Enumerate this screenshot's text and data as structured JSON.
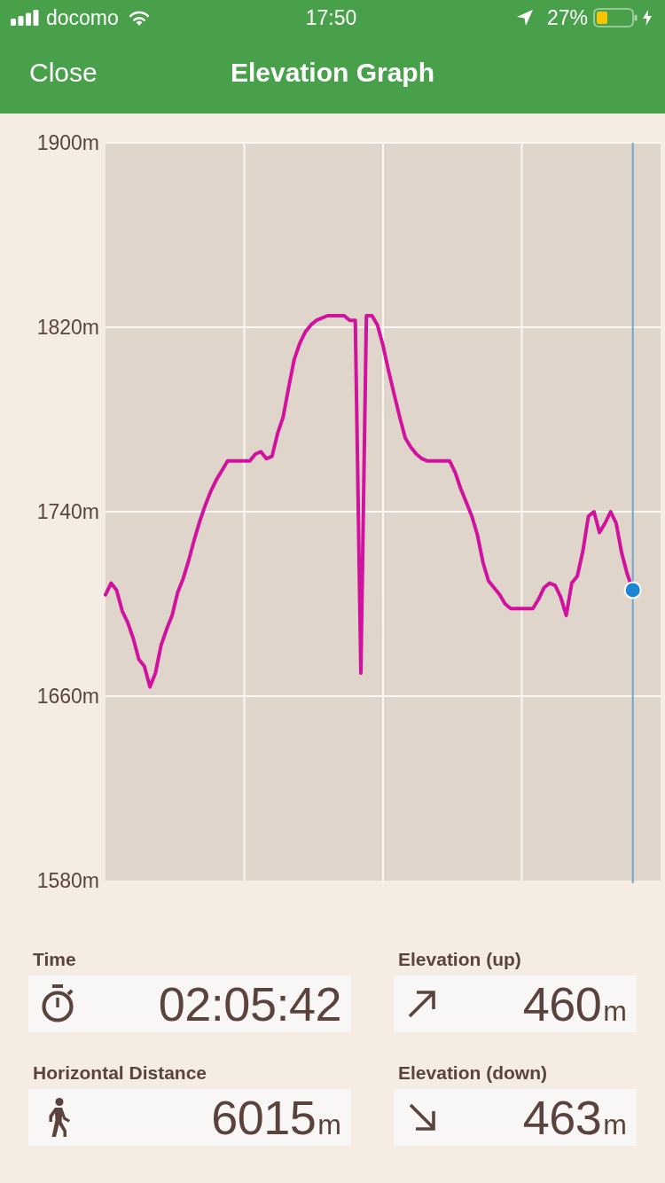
{
  "status_bar": {
    "carrier": "docomo",
    "time": "17:50",
    "battery": "27%"
  },
  "nav_bar": {
    "close_button": "Close",
    "title": "Elevation Graph"
  },
  "chart": {
    "chart_data": {
      "type": "line",
      "categories": [
        null,
        null,
        null,
        null,
        null,
        null,
        null,
        null,
        null,
        null,
        null,
        null,
        null,
        null,
        null,
        null,
        null,
        null,
        null,
        null,
        null,
        null,
        null,
        null,
        null,
        null,
        null,
        null,
        null,
        null,
        null,
        null,
        null,
        null,
        null,
        null,
        null,
        null,
        null,
        null,
        null,
        null,
        null,
        null,
        null,
        null,
        null,
        null,
        null,
        null,
        null,
        null,
        null,
        null,
        null,
        null,
        null,
        null,
        null,
        null,
        null,
        null,
        null,
        null,
        null,
        null,
        null,
        null,
        null,
        null,
        null,
        null,
        null,
        null,
        null,
        null,
        null,
        null,
        null,
        null,
        null,
        null,
        null,
        null,
        null,
        null,
        null,
        null,
        null,
        null,
        null,
        null,
        null,
        null,
        null,
        null,
        null,
        null,
        null,
        null,
        null
      ],
      "series": [
        {
          "color": "#d1129e",
          "values": [
            1704,
            1709,
            1706,
            1697,
            1692,
            1685,
            1676,
            1673,
            1664,
            1670,
            1682,
            1689,
            1695,
            1705,
            1711,
            1719,
            1728,
            1736,
            1743,
            1749,
            1754,
            1758,
            1762,
            1762,
            1762,
            1762,
            1762,
            1765,
            1766,
            1763,
            1764,
            1774,
            1781,
            1794,
            1806,
            1813,
            1818,
            1821,
            1823,
            1824,
            1825,
            1825,
            1825,
            1825,
            1823,
            1823,
            1670,
            1825,
            1825,
            1821,
            1812,
            1801,
            1791,
            1781,
            1772,
            1768,
            1765,
            1763,
            1762,
            1762,
            1762,
            1762,
            1762,
            1757,
            1750,
            1744,
            1738,
            1730,
            1718,
            1710,
            1707,
            1704,
            1700,
            1698,
            1698,
            1698,
            1698,
            1698,
            1702,
            1707,
            1709,
            1708,
            1703,
            1695,
            1709,
            1712,
            1723,
            1738,
            1740,
            1731,
            1735,
            1740,
            1735,
            1722,
            1713,
            1706,
            null,
            null,
            null,
            null,
            null
          ]
        }
      ],
      "ylim": [
        1580,
        1900
      ],
      "yticks": [
        {
          "value": 1580,
          "label": "1580m"
        },
        {
          "value": 1660,
          "label": "1660m"
        },
        {
          "value": 1740,
          "label": "1740m"
        },
        {
          "value": 1820,
          "label": "1820m"
        },
        {
          "value": 1900,
          "label": "1900m"
        }
      ],
      "grid": true
    }
  },
  "stats": [
    {
      "kind": "stopwatch",
      "label": "Time",
      "value": "02:05:42"
    },
    {
      "kind": "ascent",
      "label": "Elevation (up)",
      "value": "460",
      "unit": "m"
    },
    {
      "kind": "walking",
      "label": "Horizontal Distance",
      "value": "6015",
      "unit": "m"
    },
    {
      "kind": "descent",
      "label": "Elevation (down)",
      "value": "463",
      "unit": "m"
    }
  ]
}
